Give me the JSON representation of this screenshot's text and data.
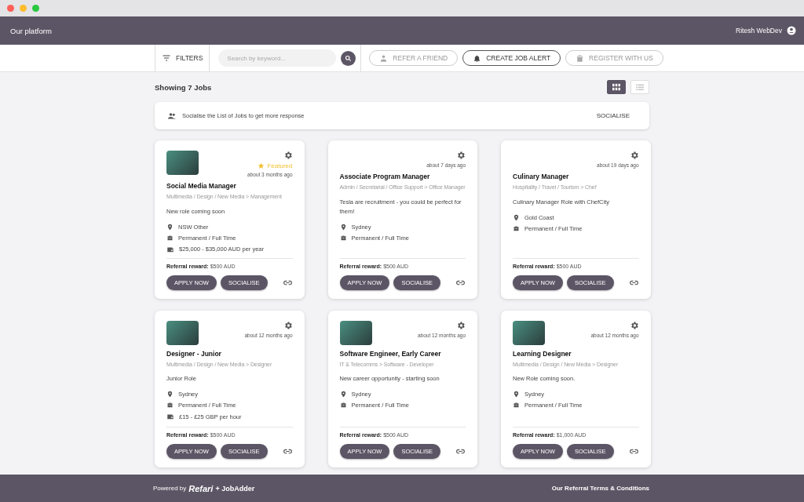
{
  "header": {
    "title": "Our platform",
    "user": "Ritesh WebDev"
  },
  "toolbar": {
    "filters": "FILTERS",
    "search": {
      "placeholder": "Search by keyword..."
    },
    "actions": [
      {
        "kind": "refer",
        "label": "REFER A FRIEND",
        "disabled": true
      },
      {
        "kind": "alert",
        "label": "CREATE JOB ALERT",
        "disabled": false
      },
      {
        "kind": "register",
        "label": "REGISTER WITH US",
        "disabled": true
      }
    ]
  },
  "results": {
    "count_label": "Showing 7 Jobs",
    "views": [
      {
        "kind": "grid",
        "selected": true
      },
      {
        "kind": "list",
        "selected": false
      }
    ]
  },
  "banner": {
    "text": "Socialise the List of Jobs to get more response",
    "action": "SOCIALISE"
  },
  "jobs": [
    {
      "photo": true,
      "featured": true,
      "featured_label": "Featured",
      "posted": "about 3 months ago",
      "title": "Social Media Manager",
      "category": "Multimedia / Design / New Media > Management",
      "summary": "New role coming soon",
      "location": "NSW Other",
      "work_type": "Permanent / Full Time",
      "salary": "$25,000 - $35,000 AUD per year",
      "reward_label": "Referral reward:",
      "reward": "$500 AUD",
      "apply": "APPLY NOW",
      "socialise": "SOCIALISE"
    },
    {
      "photo": false,
      "featured": false,
      "posted": "about 7 days ago",
      "title": "Associate Program Manager",
      "category": "Admin / Secretarial / Office Support > Office Manager",
      "summary": "Tesla are recruitment - you could be perfect for them!",
      "location": "Sydney",
      "work_type": "Permanent / Full Time",
      "reward_label": "Referral reward:",
      "reward": "$500 AUD",
      "apply": "APPLY NOW",
      "socialise": "SOCIALISE"
    },
    {
      "photo": false,
      "featured": false,
      "posted": "about 19 days ago",
      "title": "Culinary Manager",
      "category": "Hospitality / Travel / Tourism > Chef",
      "summary": "Culinary Manager Role with ChefCity",
      "location": "Gold Coast",
      "work_type": "Permanent / Full Time",
      "reward_label": "Referral reward:",
      "reward": "$500 AUD",
      "apply": "APPLY NOW",
      "socialise": "SOCIALISE"
    },
    {
      "photo": true,
      "featured": false,
      "posted": "about 12 months ago",
      "title": "Designer - Junior",
      "category": "Multimedia / Design / New Media > Designer",
      "summary": "Junior Role",
      "location": "Sydney",
      "work_type": "Permanent / Full Time",
      "salary": "£15 - £25 GBP per hour",
      "reward_label": "Referral reward:",
      "reward": "$500 AUD",
      "apply": "APPLY NOW",
      "socialise": "SOCIALISE"
    },
    {
      "photo": true,
      "featured": false,
      "posted": "about 12 months ago",
      "title": "Software Engineer, Early Career",
      "category": "IT & Telecomms > Software - Developer",
      "summary": "New career opportunity - starting soon",
      "location": "Sydney",
      "work_type": "Permanent / Full Time",
      "reward_label": "Referral reward:",
      "reward": "$500 AUD",
      "apply": "APPLY NOW",
      "socialise": "SOCIALISE"
    },
    {
      "photo": true,
      "featured": false,
      "posted": "about 12 months ago",
      "title": "Learning Designer",
      "category": "Multimedia / Design / New Media > Designer",
      "summary": "New Role coming soon.",
      "location": "Sydney",
      "work_type": "Permanent / Full Time",
      "reward_label": "Referral reward:",
      "reward": "$1,000 AUD",
      "apply": "APPLY NOW",
      "socialise": "SOCIALISE"
    }
  ],
  "footer": {
    "powered_by": "Powered by",
    "logo": "Refari",
    "partner": "+ JobAdder",
    "terms": "Our Referral Terms & Conditions"
  }
}
